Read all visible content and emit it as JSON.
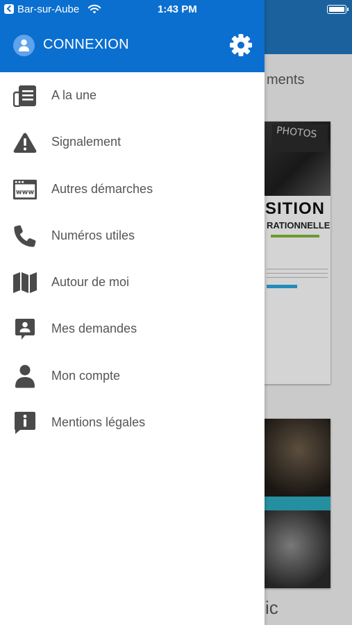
{
  "status_bar": {
    "carrier": "Bar-sur-Aube",
    "time": "1:43 PM"
  },
  "drawer": {
    "header": {
      "title": "CONNEXION",
      "accent_color": "#0b6fd0"
    },
    "menu": [
      {
        "label": "A la une",
        "icon": "newspaper-icon"
      },
      {
        "label": "Signalement",
        "icon": "warning-icon"
      },
      {
        "label": "Autres démarches",
        "icon": "www-window-icon"
      },
      {
        "label": "Numéros utiles",
        "icon": "phone-icon"
      },
      {
        "label": "Autour de moi",
        "icon": "map-icon"
      },
      {
        "label": "Mes demandes",
        "icon": "contact-bubble-icon"
      },
      {
        "label": "Mon compte",
        "icon": "user-icon"
      },
      {
        "label": "Mentions légales",
        "icon": "info-bubble-icon"
      }
    ]
  },
  "background": {
    "section_title_fragment": "ments",
    "card1": {
      "board_text": "PHOTOS",
      "headline_fragment": "SITION",
      "subheadline_fragment": "RATIONNELLE"
    },
    "bottom_text_fragment": "ic"
  }
}
